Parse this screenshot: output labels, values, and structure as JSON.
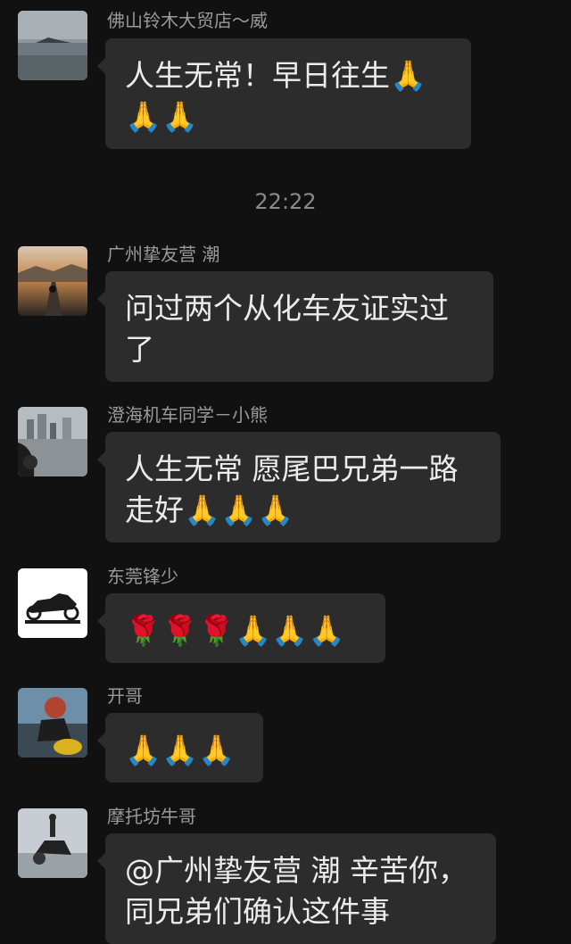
{
  "messages": [
    {
      "sender": "佛山铃木大贸店～威",
      "avatar_icon": "sea-island-avatar",
      "text": "人生无常！早日往生🙏🙏🙏"
    },
    {
      "sender": "广州挚友营 潮",
      "avatar_icon": "motorcycle-sunset-avatar",
      "text": "问过两个从化车友证实过了"
    },
    {
      "sender": "澄海机车同学－小熊",
      "avatar_icon": "motorcycle-city-avatar",
      "text": "人生无常 愿尾巴兄弟一路走好🙏🙏🙏"
    },
    {
      "sender": "东莞锋少",
      "avatar_icon": "motorcycle-logo-avatar",
      "text": "🌹🌹🌹🙏🙏🙏"
    },
    {
      "sender": "开哥",
      "avatar_icon": "helmet-rider-avatar",
      "text": "🙏🙏🙏"
    },
    {
      "sender": "摩托坊牛哥",
      "avatar_icon": "stunt-rider-avatar",
      "text": "@广州挚友营 潮 辛苦你，同兄弟们确认这件事"
    }
  ],
  "timestamp": "22:22",
  "colors": {
    "background": "#111111",
    "bubble": "#2c2c2c",
    "sender_text": "#9a9a9a",
    "message_text": "#ececec"
  }
}
